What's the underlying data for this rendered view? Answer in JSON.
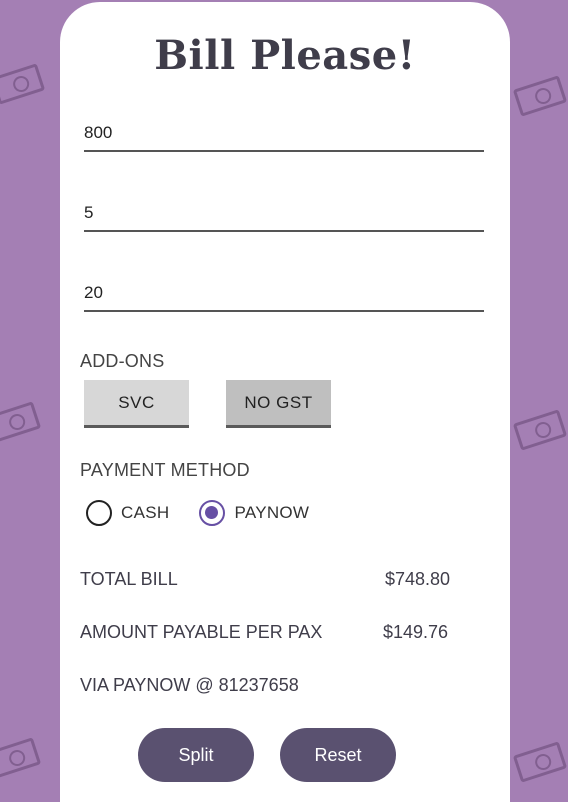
{
  "app": {
    "title": "Bill Please!"
  },
  "inputs": {
    "amount": "800",
    "pax": "5",
    "discount": "20"
  },
  "addons": {
    "label": "ADD-ONS",
    "svc_label": "SVC",
    "gst_label": "NO GST"
  },
  "payment": {
    "label": "PAYMENT METHOD",
    "options": [
      "CASH",
      "PAYNOW"
    ],
    "selected": "PAYNOW"
  },
  "results": {
    "total_label": "TOTAL BILL",
    "total_value": "$748.80",
    "per_pax_label": "AMOUNT PAYABLE PER PAX",
    "per_pax_value": "$149.76",
    "paynow_text": "VIA PAYNOW @ 81237658"
  },
  "actions": {
    "split_label": "Split",
    "reset_label": "Reset"
  },
  "colors": {
    "background": "#a47fb4",
    "accent": "#6750a4",
    "pill": "#5a5170"
  },
  "icons": {
    "background_pattern": "money-bill-icon"
  }
}
